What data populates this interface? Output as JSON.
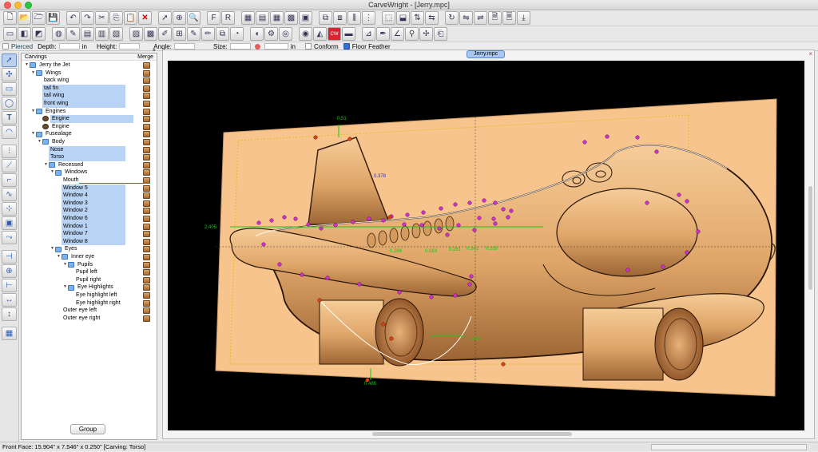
{
  "window": {
    "title": "CarveWright - [Jerry.mpc]"
  },
  "toolbar1": {
    "icons": [
      "new-icon",
      "open-icon",
      "open-folder-icon",
      "save-icon",
      "undo-icon",
      "redo-icon",
      "cut-icon",
      "copy-icon",
      "paste-icon",
      "delete-icon",
      "select-icon",
      "zoom-icon",
      "search-icon",
      "font-icon",
      "font-style-icon",
      "board-icon",
      "board-texture-icon",
      "grid-icon",
      "grid-alt-icon",
      "highlight-icon",
      "layout-icon",
      "layout-alt-icon",
      "align-icon",
      "distribute-icon",
      "group-icon",
      "ungroup-icon",
      "arrange-icon",
      "mirror-icon",
      "rotate-icon",
      "flip-icon",
      "flip-alt-icon",
      "page-icon",
      "page-alt-icon",
      "export-icon"
    ]
  },
  "toolbar2": {
    "icons": [
      "preview-icon",
      "render-icon",
      "render-3d-icon",
      "wood-icon",
      "paint-icon",
      "layer-icon",
      "layer-alt-icon",
      "texture-icon",
      "stamp-icon",
      "stamp-alt-icon",
      "brush-icon",
      "pattern-icon",
      "edit-icon",
      "edit-alt-icon",
      "copy-pattern-icon",
      "sand-icon",
      "chisel-icon",
      "gear-icon",
      "target-icon",
      "globe-icon",
      "bucket-icon",
      "cw-logo-icon",
      "board-brown-icon",
      "measure-icon",
      "pen-icon",
      "angle-icon",
      "pin-icon",
      "tools-icon",
      "clip-icon"
    ]
  },
  "options": {
    "pierced": "Pierced",
    "depth": "Depth:",
    "depth_unit": "in",
    "height": "Height:",
    "angle": "Angle:",
    "size": "Size:",
    "size_unit": "in",
    "conform": "Conform",
    "floor_feather": "Floor Feather"
  },
  "carvings_panel": {
    "title": "Carvings",
    "merge": "Merge",
    "group_button": "Group",
    "tree": [
      {
        "label": "Jerry the Jet",
        "indent": 0,
        "twisty": "▼",
        "sel": false
      },
      {
        "label": "Wings",
        "indent": 1,
        "twisty": "▼",
        "sel": false
      },
      {
        "label": "back wing",
        "indent": 2,
        "twisty": "",
        "sel": false
      },
      {
        "label": "tail fin",
        "indent": 2,
        "twisty": "",
        "sel": true
      },
      {
        "label": "tail wing",
        "indent": 2,
        "twisty": "",
        "sel": true
      },
      {
        "label": "front wing",
        "indent": 2,
        "twisty": "",
        "sel": true
      },
      {
        "label": "Engines",
        "indent": 1,
        "twisty": "▼",
        "sel": false
      },
      {
        "label": "Engine",
        "indent": 2,
        "twisty": "",
        "sel": true,
        "icon": "engine"
      },
      {
        "label": "Engine",
        "indent": 2,
        "twisty": "",
        "sel": false,
        "icon": "engine"
      },
      {
        "label": "Fusealage",
        "indent": 1,
        "twisty": "▼",
        "sel": false
      },
      {
        "label": "Body",
        "indent": 2,
        "twisty": "▼",
        "sel": false
      },
      {
        "label": "Nose",
        "indent": 3,
        "twisty": "",
        "sel": true
      },
      {
        "label": "Torso",
        "indent": 3,
        "twisty": "",
        "sel": true
      },
      {
        "label": "Recessed",
        "indent": 3,
        "twisty": "▼",
        "sel": false
      },
      {
        "label": "Windows",
        "indent": 4,
        "twisty": "▼",
        "sel": false
      },
      {
        "label": "Mouth",
        "indent": 5,
        "twisty": "",
        "sel": false
      },
      {
        "label": "Window 5",
        "indent": 5,
        "twisty": "",
        "sel": true
      },
      {
        "label": "Window 4",
        "indent": 5,
        "twisty": "",
        "sel": true
      },
      {
        "label": "Window 3",
        "indent": 5,
        "twisty": "",
        "sel": true
      },
      {
        "label": "Window 2",
        "indent": 5,
        "twisty": "",
        "sel": true
      },
      {
        "label": "Window 6",
        "indent": 5,
        "twisty": "",
        "sel": true
      },
      {
        "label": "Window 1",
        "indent": 5,
        "twisty": "",
        "sel": true
      },
      {
        "label": "Window 7",
        "indent": 5,
        "twisty": "",
        "sel": true
      },
      {
        "label": "Window 8",
        "indent": 5,
        "twisty": "",
        "sel": true
      },
      {
        "label": "Eyes",
        "indent": 4,
        "twisty": "▼",
        "sel": false
      },
      {
        "label": "Inner eye",
        "indent": 5,
        "twisty": "▼",
        "sel": false
      },
      {
        "label": "Pupils",
        "indent": 6,
        "twisty": "▼",
        "sel": false
      },
      {
        "label": "Pupil left",
        "indent": 7,
        "twisty": "",
        "sel": false
      },
      {
        "label": "Pupil right",
        "indent": 7,
        "twisty": "",
        "sel": false
      },
      {
        "label": "Eye Highlights",
        "indent": 6,
        "twisty": "▼",
        "sel": false
      },
      {
        "label": "Eye highlight left",
        "indent": 7,
        "twisty": "",
        "sel": false
      },
      {
        "label": "Eye highlight right",
        "indent": 7,
        "twisty": "",
        "sel": false
      },
      {
        "label": "Outer eye left",
        "indent": 5,
        "twisty": "",
        "sel": false
      },
      {
        "label": "Outer eye right",
        "indent": 5,
        "twisty": "",
        "sel": false
      }
    ]
  },
  "document": {
    "tab": "Jerry.mpc"
  },
  "canvas": {
    "board_color": "#f7c48e",
    "carve_color": "#e6ad72",
    "selection_color": "#cc33cc",
    "dimension_color": "#11cc11",
    "dims": [
      "0.51",
      "0.378",
      "2.405",
      "0.486",
      "1.764",
      "0.266",
      "0.083",
      "0.261",
      "0.361",
      "0.255"
    ]
  },
  "status": {
    "text": "Front Face: 15.904\" x 7.546\" x 0.250\"   [Carving: Torso]"
  }
}
